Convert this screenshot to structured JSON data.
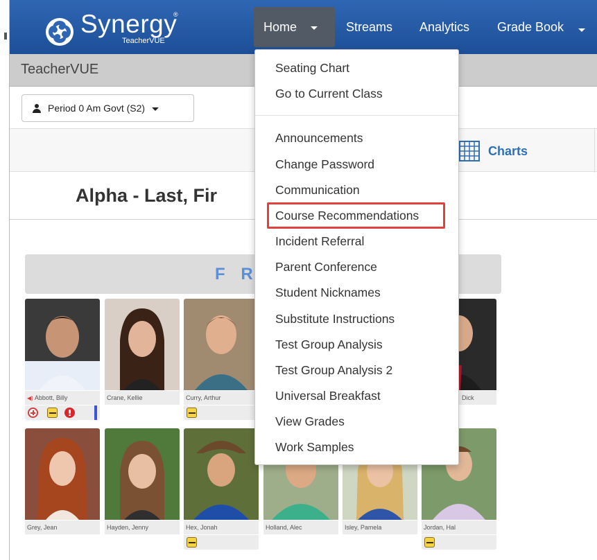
{
  "app": {
    "brand": "Synergy",
    "brand_sub": "TeacherVUE",
    "registered_mark": "®"
  },
  "nav": {
    "home": "Home",
    "streams": "Streams",
    "analytics": "Analytics",
    "gradebook": "Grade Book"
  },
  "page": {
    "app_title": "TeacherVUE",
    "period_selector": "Period 0 Am Govt (S2)",
    "charts_label": "Charts",
    "heading": "Alpha - Last, Fir",
    "front_label": "F R"
  },
  "menu": {
    "items": [
      "Seating Chart",
      "Go to Current Class",
      "Announcements",
      "Change Password",
      "Communication",
      "Course Recommendations",
      "Incident Referral",
      "Parent Conference",
      "Student Nicknames",
      "Substitute Instructions",
      "Test Group Analysis",
      "Test Group Analysis 2",
      "Universal Breakfast",
      "View Grades",
      "Work Samples"
    ],
    "highlighted": "Course Recommendations"
  },
  "students": {
    "row1": [
      "Abbott, Billy",
      "Crane, Kellie",
      "Curry, Arthur",
      "Dick"
    ],
    "row2": [
      "Grey, Jean",
      "Hayden, Jenny",
      "Hex, Jonah",
      "Holland, Alec",
      "Isley, Pamela",
      "Jordan, Hal"
    ]
  },
  "colors": {
    "navbar": "#2f66b3",
    "home_active": "#525a66",
    "charts_link": "#2f6fb6",
    "front_text": "#5b8fd6",
    "highlight_border": "#e04040"
  },
  "icons": {
    "logo": "synergy-logo-icon",
    "user": "user-icon",
    "charts": "grid-icon",
    "speaker": "speaker-icon",
    "medical": "medical-plus-icon",
    "bee": "bee-icon",
    "alert": "alert-icon"
  }
}
